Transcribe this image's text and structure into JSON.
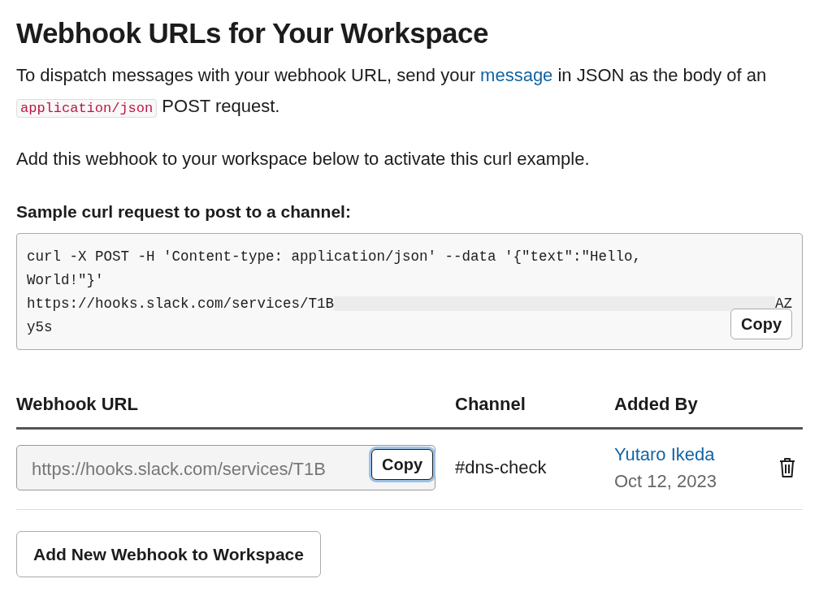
{
  "heading": "Webhook URLs for Your Workspace",
  "intro": {
    "before": "To dispatch messages with your webhook URL, send your",
    "link": "message",
    "middle": "in JSON as the body of an",
    "code": "application/json",
    "after": "POST request."
  },
  "note": "Add this webhook to your workspace below to activate this curl example.",
  "sample": {
    "label": "Sample curl request to post to a channel:",
    "lines": [
      "curl -X POST -H 'Content-type: application/json' --data '{\"text\":\"Hello,",
      "World!\"}'"
    ],
    "url_start": "https://hooks.slack.com/services/T1B",
    "url_end": "AZ",
    "last_line": "y5s",
    "copy_button": "Copy"
  },
  "table": {
    "columns": [
      "Webhook URL",
      "Channel",
      "Added By"
    ],
    "rows": [
      {
        "url": "https://hooks.slack.com/services/T1B",
        "copy_button": "Copy",
        "channel": "#dns-check",
        "added_by": "Yutaro Ikeda",
        "date": "Oct 12, 2023"
      }
    ]
  },
  "add_button": "Add New Webhook to Workspace"
}
